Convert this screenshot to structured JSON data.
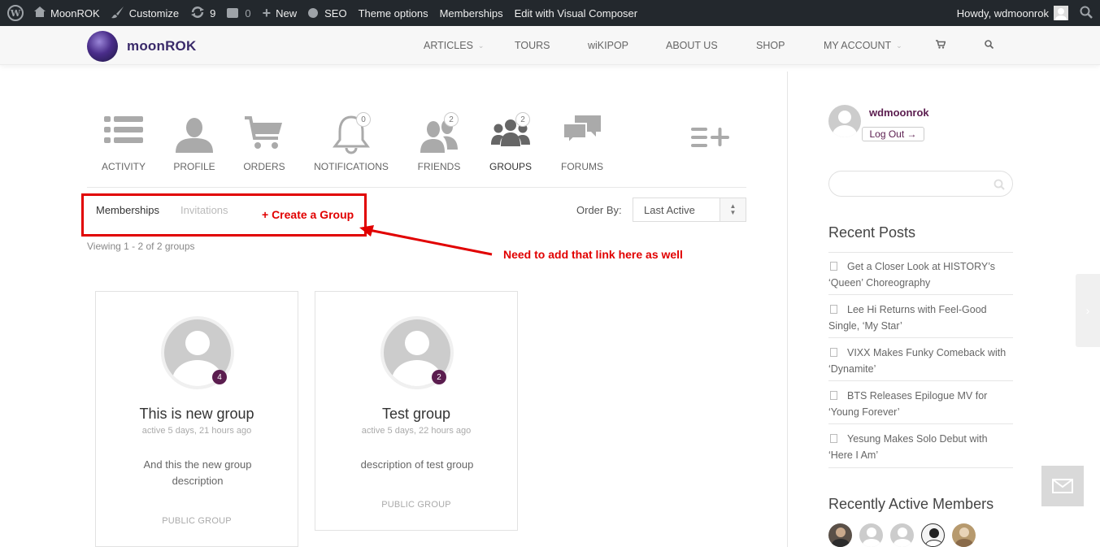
{
  "adminbar": {
    "site": "MoonROK",
    "customize": "Customize",
    "updates": "9",
    "comments": "0",
    "new": "New",
    "seo": "SEO",
    "theme_options": "Theme options",
    "memberships": "Memberships",
    "visual_composer": "Edit with Visual Composer",
    "howdy": "Howdy, wdmoonrok"
  },
  "header": {
    "logo_text": "moonROK",
    "nav": [
      "ARTICLES",
      "TOURS",
      "wiKIPOP",
      "ABOUT US",
      "SHOP",
      "MY ACCOUNT"
    ]
  },
  "profile_tabs": [
    {
      "label": "ACTIVITY",
      "icon": "activity-list-icon"
    },
    {
      "label": "PROFILE",
      "icon": "user-icon"
    },
    {
      "label": "ORDERS",
      "icon": "cart-icon"
    },
    {
      "label": "NOTIFICATIONS",
      "icon": "bell-icon",
      "count": "0"
    },
    {
      "label": "FRIENDS",
      "icon": "friends-icon",
      "count": "2"
    },
    {
      "label": "GROUPS",
      "icon": "groups-icon",
      "count": "2",
      "active": true
    },
    {
      "label": "FORUMS",
      "icon": "chat-bubbles-icon"
    }
  ],
  "groups": {
    "subtabs": [
      "Memberships",
      "Invitations"
    ],
    "create_link": "+ Create a Group",
    "order_by_label": "Order By:",
    "order_by_value": "Last Active",
    "viewing": "Viewing 1 - 2 of 2 groups",
    "annotation": "Need to add that link here as well",
    "items": [
      {
        "title": "This is new group",
        "active": "active 5 days, 21 hours ago",
        "description": "And this the new group description",
        "type": "PUBLIC GROUP",
        "members": "4"
      },
      {
        "title": "Test group",
        "active": "active 5 days, 22 hours ago",
        "description": "description of test group",
        "type": "PUBLIC GROUP",
        "members": "2"
      }
    ]
  },
  "sidebar": {
    "username": "wdmoonrok",
    "logout": "Log Out →",
    "recent_posts_title": "Recent Posts",
    "recent_posts": [
      "Get a Closer Look at HISTORY’s ‘Queen’ Choreography",
      "Lee Hi Returns with Feel-Good Single, ‘My Star’",
      "VIXX Makes Funky Comeback with ‘Dynamite’",
      "BTS Releases Epilogue MV for ‘Young Forever’",
      "Yesung Makes Solo Debut with ‘Here I Am’"
    ],
    "active_members_title": "Recently Active Members"
  },
  "colors": {
    "accent": "#5b1d4f",
    "annotation_red": "#e10000",
    "adminbar": "#23282d"
  }
}
